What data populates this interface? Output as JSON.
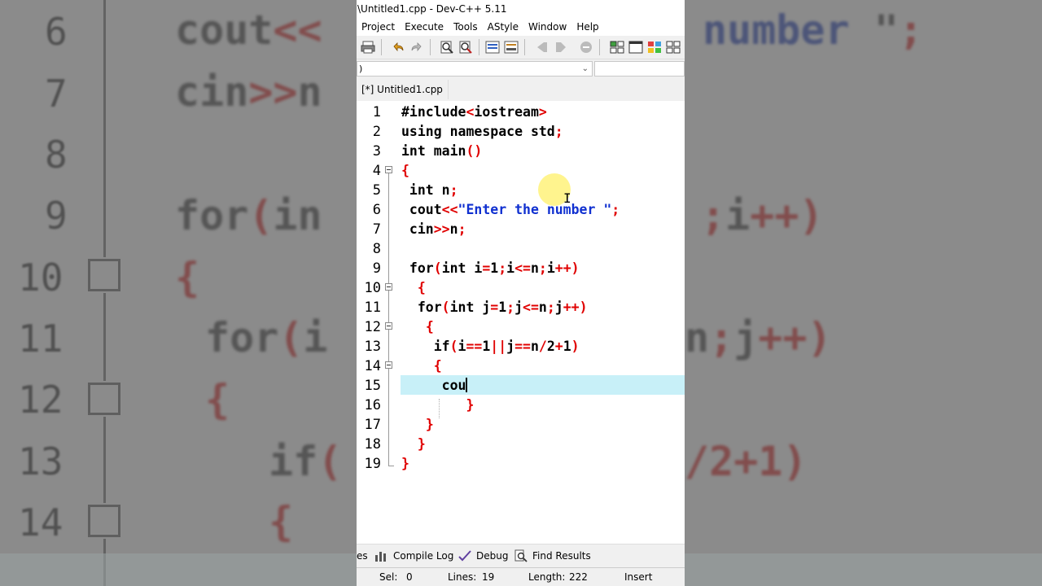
{
  "window": {
    "title": "\\Untitled1.cpp - Dev-C++ 5.11"
  },
  "menu": [
    "Project",
    "Execute",
    "Tools",
    "AStyle",
    "Window",
    "Help"
  ],
  "combo": {
    "left_value": ")",
    "right_value": ""
  },
  "tab": {
    "label": "[*] Untitled1.cpp"
  },
  "editor": {
    "line_numbers": [
      "1",
      "2",
      "3",
      "4",
      "5",
      "6",
      "7",
      "8",
      "9",
      "10",
      "11",
      "12",
      "13",
      "14",
      "15",
      "16",
      "17",
      "18",
      "19"
    ],
    "current_line_text": "cou"
  },
  "bottom_tabs": {
    "partial": "es",
    "compile_log": "Compile Log",
    "debug": "Debug",
    "find_results": "Find Results"
  },
  "status": {
    "sel_label": "Sel:",
    "sel_value": "0",
    "lines_label": "Lines:",
    "lines_value": "19",
    "length_label": "Length:",
    "length_value": "222",
    "mode": "Insert"
  },
  "colors": {
    "current_line": "#c8f0f8",
    "punctuation": "#e00000",
    "string": "#1030d0"
  },
  "background": {
    "left_numbers": [
      "6",
      "7",
      "8",
      "9",
      "10",
      "11",
      "12",
      "13",
      "14"
    ]
  }
}
